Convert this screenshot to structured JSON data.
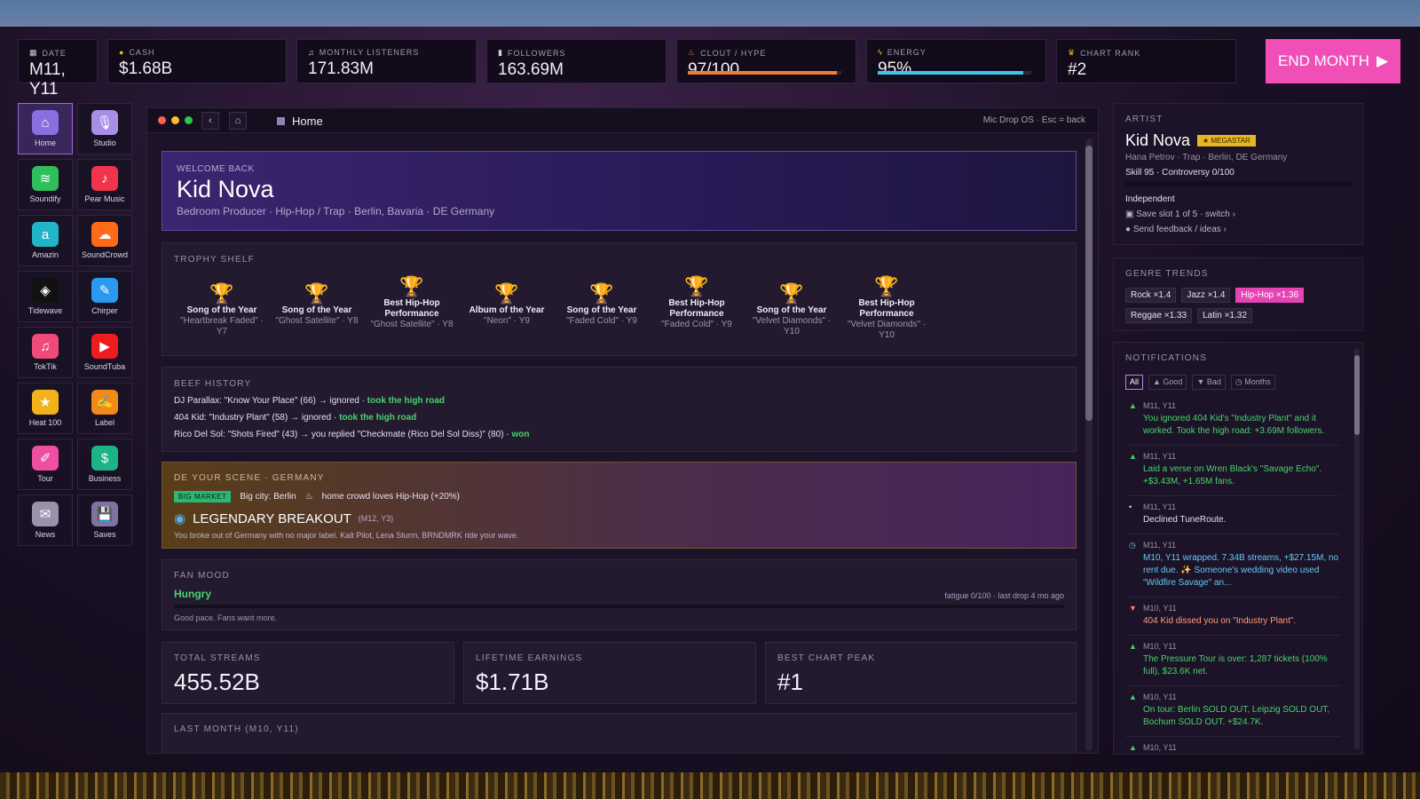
{
  "stats": {
    "date": {
      "label": "DATE",
      "value": "M11, Y11"
    },
    "cash": {
      "label": "CASH",
      "value": "$1.68B"
    },
    "listeners": {
      "label": "MONTHLY LISTENERS",
      "value": "171.83M"
    },
    "followers": {
      "label": "FOLLOWERS",
      "value": "163.69M"
    },
    "clout": {
      "label": "CLOUT / HYPE",
      "value": "97/100",
      "level": 0.97
    },
    "energy": {
      "label": "ENERGY",
      "value": "95%",
      "level": 0.95
    },
    "rank": {
      "label": "CHART RANK",
      "value": "#2"
    }
  },
  "end_month": {
    "label": "END MONTH",
    "icon": "play-icon"
  },
  "dock": [
    {
      "name": "Home",
      "icon": "⌂",
      "color": "#8b6fe0",
      "active": true
    },
    {
      "name": "Studio",
      "icon": "🎙",
      "color": "#a98ee6"
    },
    {
      "name": "Soundify",
      "icon": "≋",
      "color": "#2fbf5a"
    },
    {
      "name": "Pear Music",
      "icon": "♪",
      "color": "#f0344c"
    },
    {
      "name": "Amazin",
      "icon": "a",
      "color": "#21b5c7"
    },
    {
      "name": "SoundCrowd",
      "icon": "☁",
      "color": "#ff6a1a"
    },
    {
      "name": "Tidewave",
      "icon": "◈",
      "color": "#111111"
    },
    {
      "name": "Chirper",
      "icon": "✎",
      "color": "#2a9af0"
    },
    {
      "name": "TokTik",
      "icon": "♫",
      "color": "#f04a7a"
    },
    {
      "name": "SoundTuba",
      "icon": "▶",
      "color": "#ee1c1c"
    },
    {
      "name": "Heat 100",
      "icon": "★",
      "color": "#f2b21a"
    },
    {
      "name": "Label",
      "icon": "✍",
      "color": "#f28a1a"
    },
    {
      "name": "Tour",
      "icon": "✐",
      "color": "#ee4fa0"
    },
    {
      "name": "Business",
      "icon": "$",
      "color": "#1cb387"
    },
    {
      "name": "News",
      "icon": "✉",
      "color": "#9a92aa"
    },
    {
      "name": "Saves",
      "icon": "💾",
      "color": "#7e74a0"
    }
  ],
  "window": {
    "title": "Home",
    "hint": "Mic Drop OS · Esc = back"
  },
  "welcome": {
    "small": "WELCOME BACK",
    "name": "Kid Nova",
    "sub": "Bedroom Producer · Hip-Hop / Trap · Berlin, Bavaria · DE Germany"
  },
  "trophies": {
    "title": "TROPHY SHELF",
    "items": [
      {
        "award": "Song of the Year",
        "work": "\"Heartbreak Faded\" · Y7"
      },
      {
        "award": "Song of the Year",
        "work": "\"Ghost Satellite\" · Y8"
      },
      {
        "award": "Best Hip-Hop Performance",
        "work": "\"Ghost Satellite\" · Y8"
      },
      {
        "award": "Album of the Year",
        "work": "\"Neon\" · Y9"
      },
      {
        "award": "Song of the Year",
        "work": "\"Faded Cold\" · Y9"
      },
      {
        "award": "Best Hip-Hop Performance",
        "work": "\"Faded Cold\" · Y9"
      },
      {
        "award": "Song of the Year",
        "work": "\"Velvet Diamonds\" · Y10"
      },
      {
        "award": "Best Hip-Hop Performance",
        "work": "\"Velvet Diamonds\" · Y10"
      }
    ]
  },
  "beef": {
    "title": "BEEF HISTORY",
    "lines": [
      {
        "text": "DJ Parallax: \"Know Your Place\" (66) → ignored · ",
        "result": "took the high road"
      },
      {
        "text": "404 Kid: \"Industry Plant\" (58) → ignored · ",
        "result": "took the high road"
      },
      {
        "text": "Rico Del Sol: \"Shots Fired\" (43) → you replied \"Checkmate (Rico Del Sol Diss)\" (80) · ",
        "result": "won"
      }
    ]
  },
  "scene": {
    "title": "DE YOUR SCENE · GERMANY",
    "tag": "BIG MARKET",
    "city": "Big city: Berlin",
    "crowd": "home crowd loves Hip-Hop (+20%)",
    "breakout": "LEGENDARY BREAKOUT",
    "breakout_when": "(M12, Y3)",
    "note": "You broke out of Germany with no major label. Kalt Pilot, Lena Sturm, BRNDMRK ride your wave."
  },
  "fan_mood": {
    "title": "FAN MOOD",
    "value": "Hungry",
    "right": "fatigue 0/100 · last drop 4 mo ago",
    "note": "Good pace. Fans want more."
  },
  "totals": [
    {
      "label": "TOTAL STREAMS",
      "value": "455.52B"
    },
    {
      "label": "LIFETIME EARNINGS",
      "value": "$1.71B"
    },
    {
      "label": "BEST CHART PEAK",
      "value": "#1"
    }
  ],
  "last_month": {
    "title": "LAST MONTH (M10, Y11)"
  },
  "artist": {
    "title": "ARTIST",
    "name": "Kid Nova",
    "badge": "★ MEGASTAR",
    "sub": "Hana Petrov · Trap · Berlin, DE Germany",
    "skill": "Skill 95 · Controversy 0/100",
    "label_status": "Independent",
    "save": "Save slot 1 of 5 · switch ›",
    "feedback": "Send feedback / ideas ›"
  },
  "genres": {
    "title": "GENRE TRENDS",
    "chips": [
      {
        "text": "Rock ×1.4",
        "hot": false
      },
      {
        "text": "Jazz ×1.4",
        "hot": false
      },
      {
        "text": "Hip-Hop ×1.36",
        "hot": true
      },
      {
        "text": "Reggae ×1.33",
        "hot": false
      },
      {
        "text": "Latin ×1.32",
        "hot": false
      }
    ]
  },
  "notifications": {
    "title": "NOTIFICATIONS",
    "filters": [
      "All",
      "▲ Good",
      "▼ Bad",
      "◷ Months"
    ],
    "items": [
      {
        "kind": "good",
        "mark": "▲",
        "ts": "M11, Y11",
        "text": "You ignored 404 Kid's \"Industry Plant\" and it worked. Took the high road: +3.69M followers."
      },
      {
        "kind": "good",
        "mark": "▲",
        "ts": "M11, Y11",
        "text": "Laid a verse on Wren Black's \"Savage Echo\". +$3.43M, +1.65M fans."
      },
      {
        "kind": "neutral",
        "mark": "•",
        "ts": "M11, Y11",
        "text": "Declined TuneRoute."
      },
      {
        "kind": "month",
        "mark": "◷",
        "ts": "M11, Y11",
        "text": "M10, Y11 wrapped. 7.34B streams, +$27.15M, no rent due. ✨ Someone's wedding video used \"Wildfire Savage\" an..."
      },
      {
        "kind": "bad",
        "mark": "▼",
        "ts": "M10, Y11",
        "text": "404 Kid dissed you on \"Industry Plant\"."
      },
      {
        "kind": "good",
        "mark": "▲",
        "ts": "M10, Y11",
        "text": "The Pressure Tour is over: 1,287 tickets (100% full), $23.6K net."
      },
      {
        "kind": "good",
        "mark": "▲",
        "ts": "M10, Y11",
        "text": "On tour: Berlin SOLD OUT, Leipzig SOLD OUT, Bochum SOLD OUT. +$24.7K."
      },
      {
        "kind": "good",
        "mark": "▲",
        "ts": "M10, Y11",
        "text": ""
      }
    ]
  },
  "colors": {
    "accent": "#f04fb8",
    "clout_bar": "#f08030",
    "energy_bar": "#3bc7ef",
    "good": "#47d36a",
    "month": "#64c8f2"
  }
}
